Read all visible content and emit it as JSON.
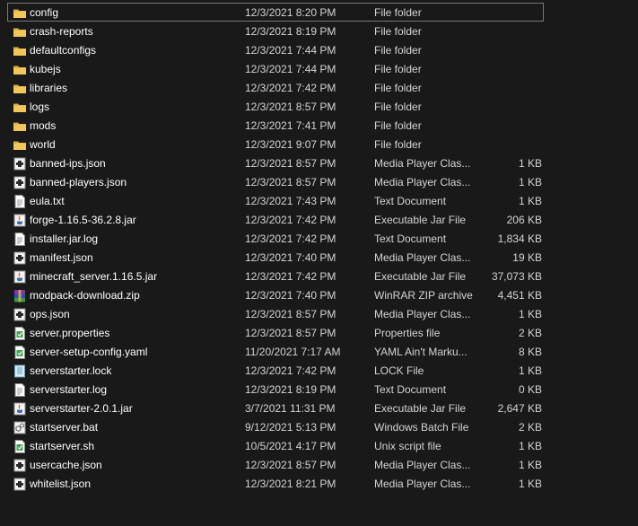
{
  "colors": {
    "background": "#191919",
    "text": "#ffffff",
    "text_secondary": "#d4d4d4",
    "selection_border": "#777777",
    "folder": "#e9c25a"
  },
  "files": [
    {
      "name": "config",
      "date": "12/3/2021 8:20 PM",
      "type": "File folder",
      "size": "",
      "icon": "folder-icon"
    },
    {
      "name": "crash-reports",
      "date": "12/3/2021 8:19 PM",
      "type": "File folder",
      "size": "",
      "icon": "folder-icon"
    },
    {
      "name": "defaultconfigs",
      "date": "12/3/2021 7:44 PM",
      "type": "File folder",
      "size": "",
      "icon": "folder-icon"
    },
    {
      "name": "kubejs",
      "date": "12/3/2021 7:44 PM",
      "type": "File folder",
      "size": "",
      "icon": "folder-icon"
    },
    {
      "name": "libraries",
      "date": "12/3/2021 7:42 PM",
      "type": "File folder",
      "size": "",
      "icon": "folder-icon"
    },
    {
      "name": "logs",
      "date": "12/3/2021 8:57 PM",
      "type": "File folder",
      "size": "",
      "icon": "folder-icon"
    },
    {
      "name": "mods",
      "date": "12/3/2021 7:41 PM",
      "type": "File folder",
      "size": "",
      "icon": "folder-icon"
    },
    {
      "name": "world",
      "date": "12/3/2021 9:07 PM",
      "type": "File folder",
      "size": "",
      "icon": "folder-icon"
    },
    {
      "name": "banned-ips.json",
      "date": "12/3/2021 8:57 PM",
      "type": "Media Player Clas...",
      "size": "1 KB",
      "icon": "media-file-icon"
    },
    {
      "name": "banned-players.json",
      "date": "12/3/2021 8:57 PM",
      "type": "Media Player Clas...",
      "size": "1 KB",
      "icon": "media-file-icon"
    },
    {
      "name": "eula.txt",
      "date": "12/3/2021 7:43 PM",
      "type": "Text Document",
      "size": "1 KB",
      "icon": "text-file-icon"
    },
    {
      "name": "forge-1.16.5-36.2.8.jar",
      "date": "12/3/2021 7:42 PM",
      "type": "Executable Jar File",
      "size": "206 KB",
      "icon": "jar-file-icon"
    },
    {
      "name": "installer.jar.log",
      "date": "12/3/2021 7:42 PM",
      "type": "Text Document",
      "size": "1,834 KB",
      "icon": "text-file-icon"
    },
    {
      "name": "manifest.json",
      "date": "12/3/2021 7:40 PM",
      "type": "Media Player Clas...",
      "size": "19 KB",
      "icon": "media-file-icon"
    },
    {
      "name": "minecraft_server.1.16.5.jar",
      "date": "12/3/2021 7:42 PM",
      "type": "Executable Jar File",
      "size": "37,073 KB",
      "icon": "jar-file-icon"
    },
    {
      "name": "modpack-download.zip",
      "date": "12/3/2021 7:40 PM",
      "type": "WinRAR ZIP archive",
      "size": "4,451 KB",
      "icon": "zip-archive-icon"
    },
    {
      "name": "ops.json",
      "date": "12/3/2021 8:57 PM",
      "type": "Media Player Clas...",
      "size": "1 KB",
      "icon": "media-file-icon"
    },
    {
      "name": "server.properties",
      "date": "12/3/2021 8:57 PM",
      "type": "Properties file",
      "size": "2 KB",
      "icon": "properties-file-icon"
    },
    {
      "name": "server-setup-config.yaml",
      "date": "11/20/2021 7:17 AM",
      "type": "YAML Ain't Marku...",
      "size": "8 KB",
      "icon": "properties-file-icon"
    },
    {
      "name": "serverstarter.lock",
      "date": "12/3/2021 7:42 PM",
      "type": "LOCK File",
      "size": "1 KB",
      "icon": "lock-file-icon"
    },
    {
      "name": "serverstarter.log",
      "date": "12/3/2021 8:19 PM",
      "type": "Text Document",
      "size": "0 KB",
      "icon": "text-file-icon"
    },
    {
      "name": "serverstarter-2.0.1.jar",
      "date": "3/7/2021 11:31 PM",
      "type": "Executable Jar File",
      "size": "2,647 KB",
      "icon": "jar-file-icon"
    },
    {
      "name": "startserver.bat",
      "date": "9/12/2021 5:13 PM",
      "type": "Windows Batch File",
      "size": "2 KB",
      "icon": "batch-file-icon"
    },
    {
      "name": "startserver.sh",
      "date": "10/5/2021 4:17 PM",
      "type": "Unix script file",
      "size": "1 KB",
      "icon": "properties-file-icon"
    },
    {
      "name": "usercache.json",
      "date": "12/3/2021 8:57 PM",
      "type": "Media Player Clas...",
      "size": "1 KB",
      "icon": "media-file-icon"
    },
    {
      "name": "whitelist.json",
      "date": "12/3/2021 8:21 PM",
      "type": "Media Player Clas...",
      "size": "1 KB",
      "icon": "media-file-icon"
    }
  ]
}
